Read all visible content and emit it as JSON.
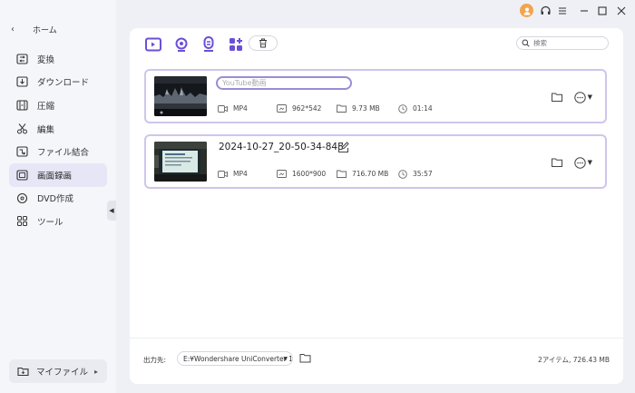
{
  "sidebar": {
    "home_label": "ホーム",
    "items": [
      {
        "label": "変換",
        "icon": "convert-icon"
      },
      {
        "label": "ダウンロード",
        "icon": "download-icon"
      },
      {
        "label": "圧縮",
        "icon": "compress-icon"
      },
      {
        "label": "編集",
        "icon": "scissors-icon"
      },
      {
        "label": "ファイル結合",
        "icon": "merge-icon"
      },
      {
        "label": "画面録画",
        "icon": "screen-record-icon",
        "active": true
      },
      {
        "label": "DVD作成",
        "icon": "dvd-icon"
      },
      {
        "label": "ツール",
        "icon": "tools-icon"
      }
    ],
    "my_files_label": "マイファイル"
  },
  "search": {
    "placeholder": "検索"
  },
  "files": [
    {
      "name_value": "YouTube動画",
      "format": "MP4",
      "resolution": "962*542",
      "size": "9.73 MB",
      "duration": "01:14",
      "editing": true
    },
    {
      "name": "2024-10-27_20-50-34-848",
      "format": "MP4",
      "resolution": "1600*900",
      "size": "716.70 MB",
      "duration": "35:57",
      "editing": false
    }
  ],
  "footer": {
    "output_label": "出力先:",
    "output_path": "E:¥Wondershare UniConverter 1",
    "summary": "2アイテム, 726.43 MB"
  },
  "colors": {
    "accent": "#6c4fd8",
    "card_border": "#cfc5ec",
    "active_nav": "#e7e6f6"
  }
}
